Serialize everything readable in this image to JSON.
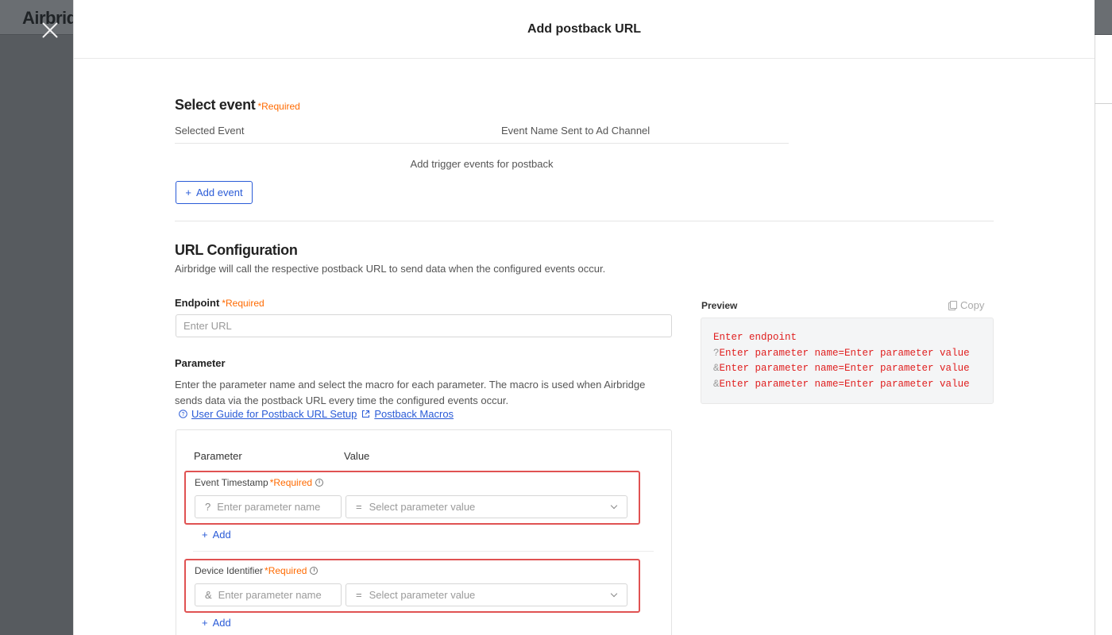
{
  "background": {
    "logo_text": "Airbridge"
  },
  "modal": {
    "title": "Add postback URL"
  },
  "select_event": {
    "heading": "Select event",
    "required_label": "*Required",
    "columns": [
      "Selected Event",
      "Event Name Sent to Ad Channel"
    ],
    "empty_text": "Add trigger events for postback",
    "add_button_label": "Add event"
  },
  "url_config": {
    "heading": "URL Configuration",
    "description": "Airbridge will call the respective postback URL to send data when the configured events occur.",
    "endpoint": {
      "label": "Endpoint",
      "required_label": "*Required",
      "placeholder": "Enter URL"
    },
    "parameter": {
      "label": "Parameter",
      "description": "Enter the parameter name and select the macro for each parameter. The macro is used when Airbridge sends data via the postback URL every time the configured events occur.",
      "links": [
        "User Guide for Postback URL Setup",
        "Postback Macros"
      ],
      "table_headers": {
        "parameter": "Parameter",
        "value": "Value"
      },
      "rows": [
        {
          "title": "Event Timestamp",
          "required_label": "*Required",
          "prefix": "?",
          "name_placeholder": "Enter parameter name",
          "value_prefix": "=",
          "value_placeholder": "Select parameter value",
          "add_label": "Add"
        },
        {
          "title": "Device Identifier",
          "required_label": "*Required",
          "prefix": "&",
          "name_placeholder": "Enter parameter name",
          "value_prefix": "=",
          "value_placeholder": "Select parameter value",
          "add_label": "Add"
        }
      ]
    }
  },
  "preview": {
    "label": "Preview",
    "copy_label": "Copy",
    "lines": [
      {
        "sep": "",
        "text": "Enter endpoint"
      },
      {
        "sep": "?",
        "text": "Enter parameter name=Enter parameter value"
      },
      {
        "sep": "&",
        "text": "Enter parameter name=Enter parameter value"
      },
      {
        "sep": "&",
        "text": "Enter parameter name=Enter parameter value"
      }
    ]
  },
  "colors": {
    "accent": "#2a5bd7",
    "required": "#ff6a00",
    "preview_text": "#e02020",
    "highlight_frame": "#e05252"
  }
}
